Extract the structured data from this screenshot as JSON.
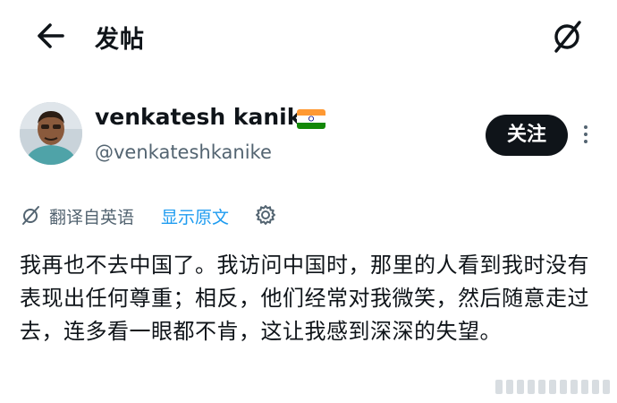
{
  "header": {
    "title": "发帖",
    "back_icon": "arrow-left-icon",
    "brand_icon": "grok-slash-circle-icon"
  },
  "author": {
    "display_name": "venkatesh kanike",
    "flag": "india-flag-emoji",
    "handle": "@venkateshkanike",
    "avatar": "profile-photo"
  },
  "actions": {
    "follow_label": "关注",
    "more_icon": "more-vertical-icon"
  },
  "translation": {
    "label": "翻译自英语",
    "show_original": "显示原文",
    "icon": "translate-icon",
    "settings_icon": "gear-icon"
  },
  "tweet": {
    "text": "我再也不去中国了。我访问中国时，那里的人看到我时没有表现出任何尊重；相反，他们经常对我微笑，然后随意走过去，连多看一眼都不肯，这让我感到深深的失望。"
  },
  "colors": {
    "text": "#0f1419",
    "secondary": "#536471",
    "link": "#1d9bf0",
    "button_bg": "#0f1419"
  }
}
